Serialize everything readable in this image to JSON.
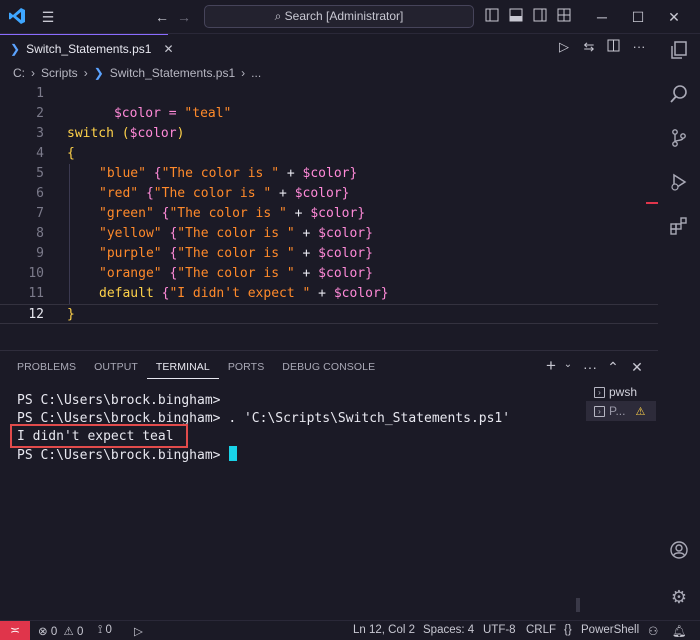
{
  "titlebar": {
    "search_text": "Search [Administrator]"
  },
  "editor_tab": {
    "label": "Switch_Statements.ps1"
  },
  "breadcrumb": {
    "drive": "C:",
    "folder": "Scripts",
    "file": "Switch_Statements.ps1",
    "more": "..."
  },
  "code_lines": [
    {
      "num": "1"
    },
    {
      "num": "2"
    },
    {
      "num": "3"
    },
    {
      "num": "4"
    },
    {
      "num": "5"
    },
    {
      "num": "6"
    },
    {
      "num": "7"
    },
    {
      "num": "8"
    },
    {
      "num": "9"
    },
    {
      "num": "10"
    },
    {
      "num": "11"
    },
    {
      "num": "12"
    }
  ],
  "code": {
    "l1_var": "$color",
    "l1_eq": " = ",
    "l1_str": "\"teal\"",
    "l3_kw": "switch",
    "l3_open": " (",
    "l3_var": "$color",
    "l3_close": ")",
    "brace_open": "{",
    "brace_close": "}",
    "cases": [
      {
        "key": "\"blue\"",
        "msg": "\"The color is \""
      },
      {
        "key": "\"red\"",
        "msg": "\"The color is \""
      },
      {
        "key": "\"green\"",
        "msg": "\"The color is \""
      },
      {
        "key": "\"yellow\"",
        "msg": "\"The color is \""
      },
      {
        "key": "\"purple\"",
        "msg": "\"The color is \""
      },
      {
        "key": "\"orange\"",
        "msg": "\"The color is \""
      }
    ],
    "default_kw": "default",
    "default_msg": "\"I didn't expect \"",
    "plus": " + ",
    "var": "$color",
    "inner_open": " {",
    "inner_close": "}"
  },
  "panel": {
    "tabs": [
      "PROBLEMS",
      "OUTPUT",
      "TERMINAL",
      "PORTS",
      "DEBUG CONSOLE"
    ],
    "active_tab": "TERMINAL"
  },
  "terminal": {
    "line1": "PS C:\\Users\\brock.bingham>",
    "line2": "PS C:\\Users\\brock.bingham> . 'C:\\Scripts\\Switch_Statements.ps1'",
    "line3": "I didn't expect teal",
    "line4": "PS C:\\Users\\brock.bingham> "
  },
  "terminal_list": {
    "item1": "pwsh",
    "item2": "P..."
  },
  "statusbar": {
    "errors": "0",
    "warnings": "0",
    "ports": "0",
    "position": "Ln 12, Col 2",
    "spaces": "Spaces: 4",
    "encoding": "UTF-8",
    "eol": "CRLF",
    "language_braces": "{}",
    "language": "PowerShell"
  },
  "colors": {
    "accent": "#8a6cff",
    "remote": "#e0354b",
    "highlight": "#e14b4b",
    "cursor": "#19d3e8"
  }
}
